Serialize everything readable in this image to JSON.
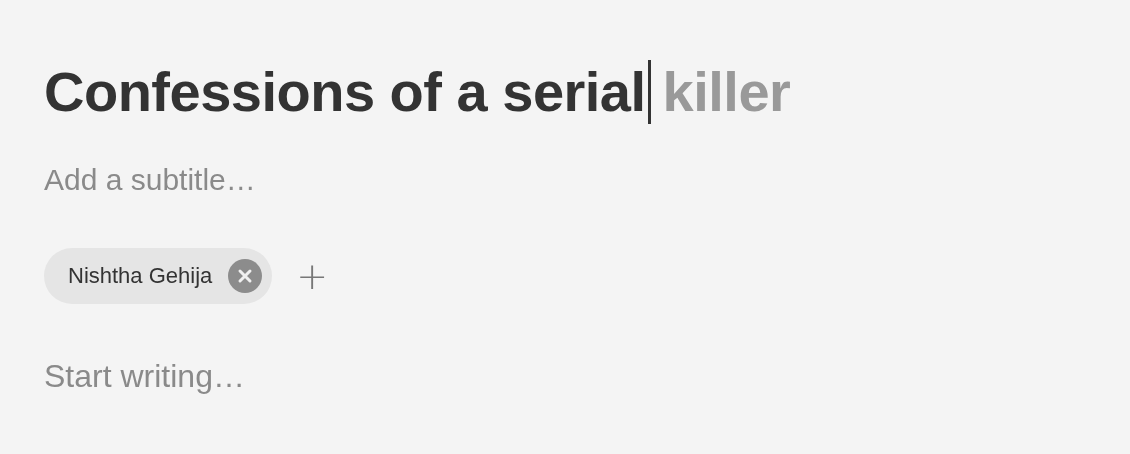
{
  "title": {
    "value": "Confessions of a serial",
    "suggestion": "killer"
  },
  "subtitle": {
    "placeholder": "Add a subtitle…"
  },
  "authors": [
    {
      "name": "Nishtha Gehija"
    }
  ],
  "add_author": "+",
  "body": {
    "placeholder": "Start writing…"
  }
}
